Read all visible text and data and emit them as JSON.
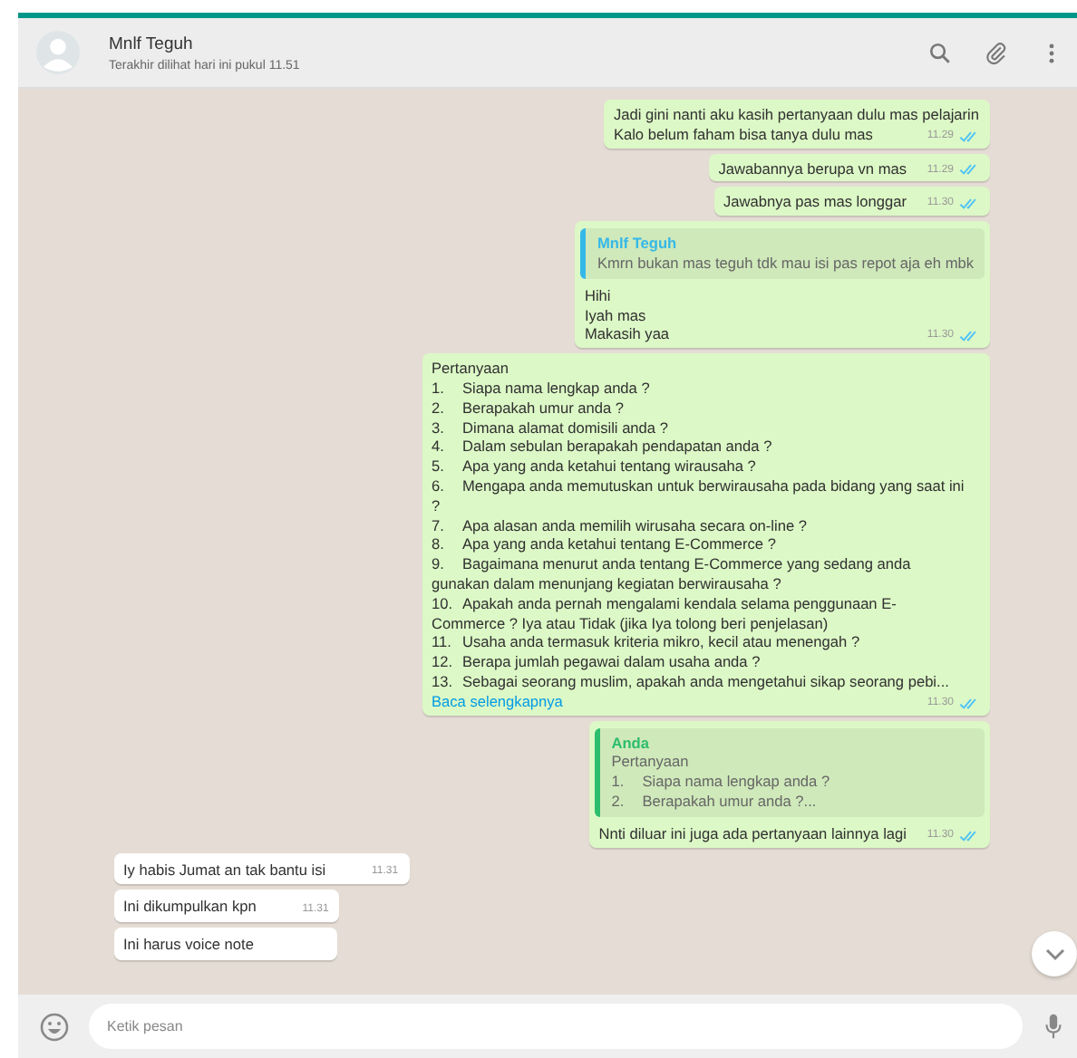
{
  "header": {
    "name": "Mnlf Teguh",
    "status": "Terakhir dilihat hari ini pukul 11.51"
  },
  "messages": [
    {
      "kind": "out",
      "lines": [
        {
          "text": "Jadi gini nanti aku kasih pertanyaan dulu mas pelajarin"
        },
        {
          "text": "Kalo belum faham bisa tanya dulu mas"
        }
      ],
      "time": "11.29",
      "read": true
    },
    {
      "kind": "out",
      "lines": [
        {
          "text": "Jawabannya berupa vn mas"
        }
      ],
      "time": "11.29",
      "read": true
    },
    {
      "kind": "out",
      "lines": [
        {
          "text": "Jawabnya pas mas longgar"
        }
      ],
      "time": "11.30",
      "read": true
    },
    {
      "kind": "out",
      "quote": {
        "author": "Mnlf Teguh",
        "color": "#35b8e8",
        "lines": [
          {
            "text": "Kmrn bukan mas teguh tdk mau isi pas repot aja eh mbk"
          }
        ]
      },
      "lines": [
        {
          "text": "Hihi"
        },
        {
          "text": "Iyah mas"
        },
        {
          "text": "Makasih yaa"
        }
      ],
      "time": "11.30",
      "read": true
    },
    {
      "kind": "out",
      "lines": [
        {
          "text": "Pertanyaan"
        },
        {
          "num": "1.",
          "text": "Siapa nama lengkap anda ?"
        },
        {
          "num": "2.",
          "text": "Berapakah umur anda ?"
        },
        {
          "num": "3.",
          "text": "Dimana alamat domisili anda ?"
        },
        {
          "num": "4.",
          "text": "Dalam sebulan berapakah pendapatan anda ?"
        },
        {
          "num": "5.",
          "text": "Apa yang anda ketahui tentang wirausaha ?"
        },
        {
          "num": "6.",
          "text": "Mengapa anda memutuskan untuk berwirausaha pada bidang yang saat ini ?"
        },
        {
          "num": "7.",
          "text": "Apa alasan anda memilih wirusaha secara on-line ?"
        },
        {
          "num": "8.",
          "text": "Apa yang anda ketahui tentang E-Commerce ?"
        },
        {
          "num": "9.",
          "text": "Bagaimana menurut anda tentang E-Commerce yang sedang anda gunakan dalam menunjang kegiatan berwirausaha ?"
        },
        {
          "num": "10.",
          "text": "Apakah anda pernah mengalami kendala selama penggunaan E-Commerce ? Iya atau Tidak (jika Iya tolong beri penjelasan)"
        },
        {
          "num": "11.",
          "text": "Usaha anda termasuk kriteria mikro, kecil atau menengah ?"
        },
        {
          "num": "12.",
          "text": "Berapa jumlah pegawai dalam usaha anda ?"
        },
        {
          "num": "13.",
          "text": "Sebagai seorang muslim, apakah anda mengetahui sikap seorang pebi..."
        }
      ],
      "more": "Baca selengkapnya",
      "time": "11.30",
      "read": true
    },
    {
      "kind": "out",
      "quote": {
        "author": "Anda",
        "color": "#2dbd6e",
        "lines": [
          {
            "text": "Pertanyaan"
          },
          {
            "num": "1.",
            "text": "Siapa nama lengkap anda ?"
          },
          {
            "num": "2.",
            "text": "Berapakah umur anda ?..."
          }
        ]
      },
      "lines": [
        {
          "text": "Nnti diluar ini juga ada pertanyaan lainnya lagi"
        }
      ],
      "time": "11.30",
      "read": true
    },
    {
      "kind": "in",
      "lines": [
        {
          "text": "Iy habis Jumat an tak bantu isi"
        }
      ],
      "time": "11.31"
    },
    {
      "kind": "in",
      "lines": [
        {
          "text": "Ini dikumpulkan kpn"
        }
      ],
      "time": "11.31"
    },
    {
      "kind": "in",
      "lines": [
        {
          "text": "Ini harus voice note"
        }
      ]
    }
  ],
  "composer": {
    "placeholder": "Ketik pesan"
  }
}
